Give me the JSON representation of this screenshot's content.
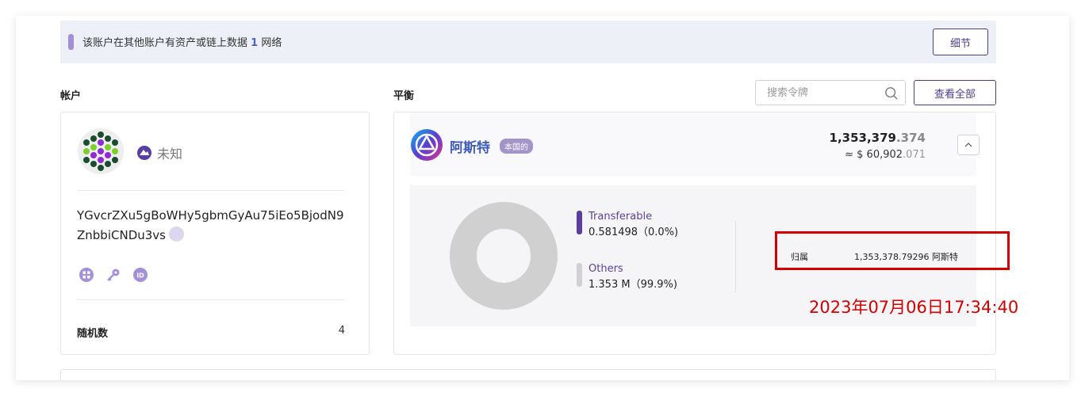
{
  "notice": {
    "text_before": "该账户在其他账户有资产或链上数据 ",
    "count": "1",
    "text_after": " 网络",
    "details_button": "细节"
  },
  "account": {
    "section_title": "帐户",
    "identity_status": "未知",
    "address": "YGvcrZXu5gBoWHy5gbmGyAu75iEo5BjodN9ZnbbiCNDu3vs",
    "icons": [
      "qr-code-icon",
      "key-icon",
      "id-icon"
    ],
    "nonce_label": "随机数",
    "nonce_value": "4"
  },
  "balance": {
    "section_title": "平衡",
    "search_placeholder": "搜索令牌",
    "view_all_button": "查看全部",
    "token": {
      "name": "阿斯特",
      "badge": "本国的",
      "amount_int": "1,353,379",
      "amount_dec": ".374",
      "fiat_prefix": "≈ $ 60,902",
      "fiat_dec": ".071"
    },
    "breakdown": [
      {
        "name": "Transferable",
        "value": "0.581498（0.0%)",
        "share": 0.0,
        "color": "#5b3fa0"
      },
      {
        "name": "Others",
        "value": "1.353 M（99.9%)",
        "share": 99.9,
        "color": "#d0d0d0"
      }
    ],
    "locked_label": "归属",
    "locked_value": "1,353,378.79296 阿斯特"
  },
  "annotation": {
    "timestamp": "2023年07月06日17:34:40",
    "color": "#d40000"
  }
}
